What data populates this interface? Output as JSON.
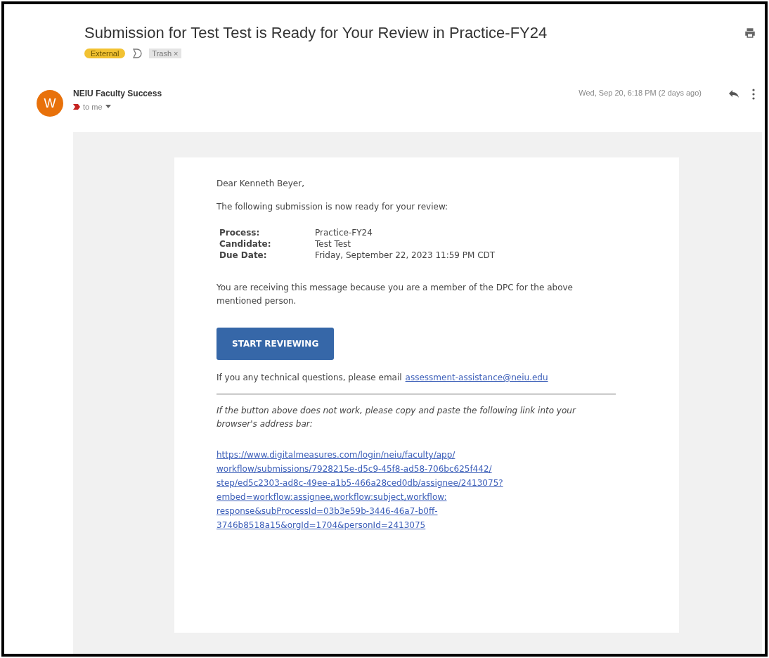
{
  "subject": "Submission for Test Test is Ready for Your Review in Practice-FY24",
  "labels": [
    {
      "kind": "tag",
      "text": "External"
    },
    {
      "kind": "chip",
      "text": "Trash",
      "remove": "×"
    }
  ],
  "sender": {
    "avatar": "W",
    "name": "NEIU Faculty Success",
    "recipient": "to me",
    "date": "Wed, Sep 20, 6:18 PM (2 days ago)"
  },
  "body": {
    "greeting": "Dear Kenneth Beyer,",
    "intro": "The following submission is now ready for your review:",
    "details": [
      {
        "label": "Process:",
        "value": "Practice-FY24"
      },
      {
        "label": "Candidate:",
        "value": "Test Test"
      },
      {
        "label": "Due Date:",
        "value": "Friday, September 22, 2023 11:59 PM CDT"
      }
    ],
    "reason": "You are receiving this message because you are a member of the DPC for the above mentioned person.",
    "button": "START REVIEWING",
    "help_text": "If you any technical questions, please email",
    "help_email": "assessment-assistance@neiu.edu",
    "fallback": "If the button above does not work, please copy and paste the following link into your browser's address bar:",
    "link_lines": [
      "https://www.digitalmeasures.com/login/neiu/faculty/app/",
      "workflow/submissions/7928215e-d5c9-45f8-ad58-706bc625f442/",
      "step/ed5c2303-ad8c-49ee-a1b5-466a28ced0db/assignee/2413075?",
      "embed=workflow:assignee,workflow:subject,workflow:",
      "response&subProcessId=03b3e59b-3446-46a7-b0ff-",
      "3746b8518a15&orgId=1704&personId=2413075"
    ]
  }
}
